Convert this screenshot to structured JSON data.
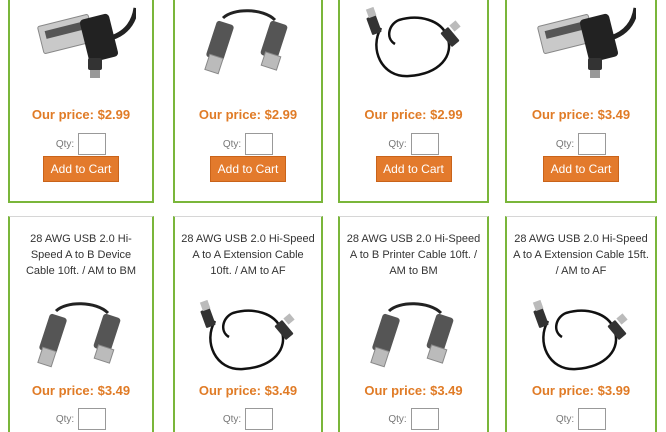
{
  "qty_label": "Qty:",
  "add_to_cart_label": "Add to Cart",
  "top_row": [
    {
      "price": "Our price: $2.99",
      "image": "usb-a-to-mini-b-connector-icon"
    },
    {
      "price": "Our price: $2.99",
      "image": "usb-a-to-b-cable-icon"
    },
    {
      "price": "Our price: $2.99",
      "image": "coiled-usb-cable-icon"
    },
    {
      "price": "Our price: $3.49",
      "image": "usb-a-to-mini-b-connector-icon"
    }
  ],
  "bottom_row": [
    {
      "title": "28 AWG USB 2.0 Hi-Speed A to B Device Cable 10ft. / AM to BM",
      "price": "Our price: $3.49",
      "image": "usb-a-to-b-cable-icon"
    },
    {
      "title": "28 AWG USB 2.0 Hi-Speed A to A Extension Cable 10ft. / AM to AF",
      "price": "Our price: $3.49",
      "image": "coiled-usb-cable-icon"
    },
    {
      "title": "28 AWG USB 2.0 Hi-Speed A to B Printer Cable 10ft. / AM to BM",
      "price": "Our price: $3.49",
      "image": "usb-a-to-b-cable-icon"
    },
    {
      "title": "28 AWG USB 2.0 Hi-Speed A to A Extension Cable 15ft. / AM to AF",
      "price": "Our price: $3.99",
      "image": "coiled-usb-cable-icon"
    }
  ],
  "colors": {
    "accent_green": "#7ab63a",
    "price_orange": "#e07b26",
    "button_orange": "#e37a2c"
  }
}
